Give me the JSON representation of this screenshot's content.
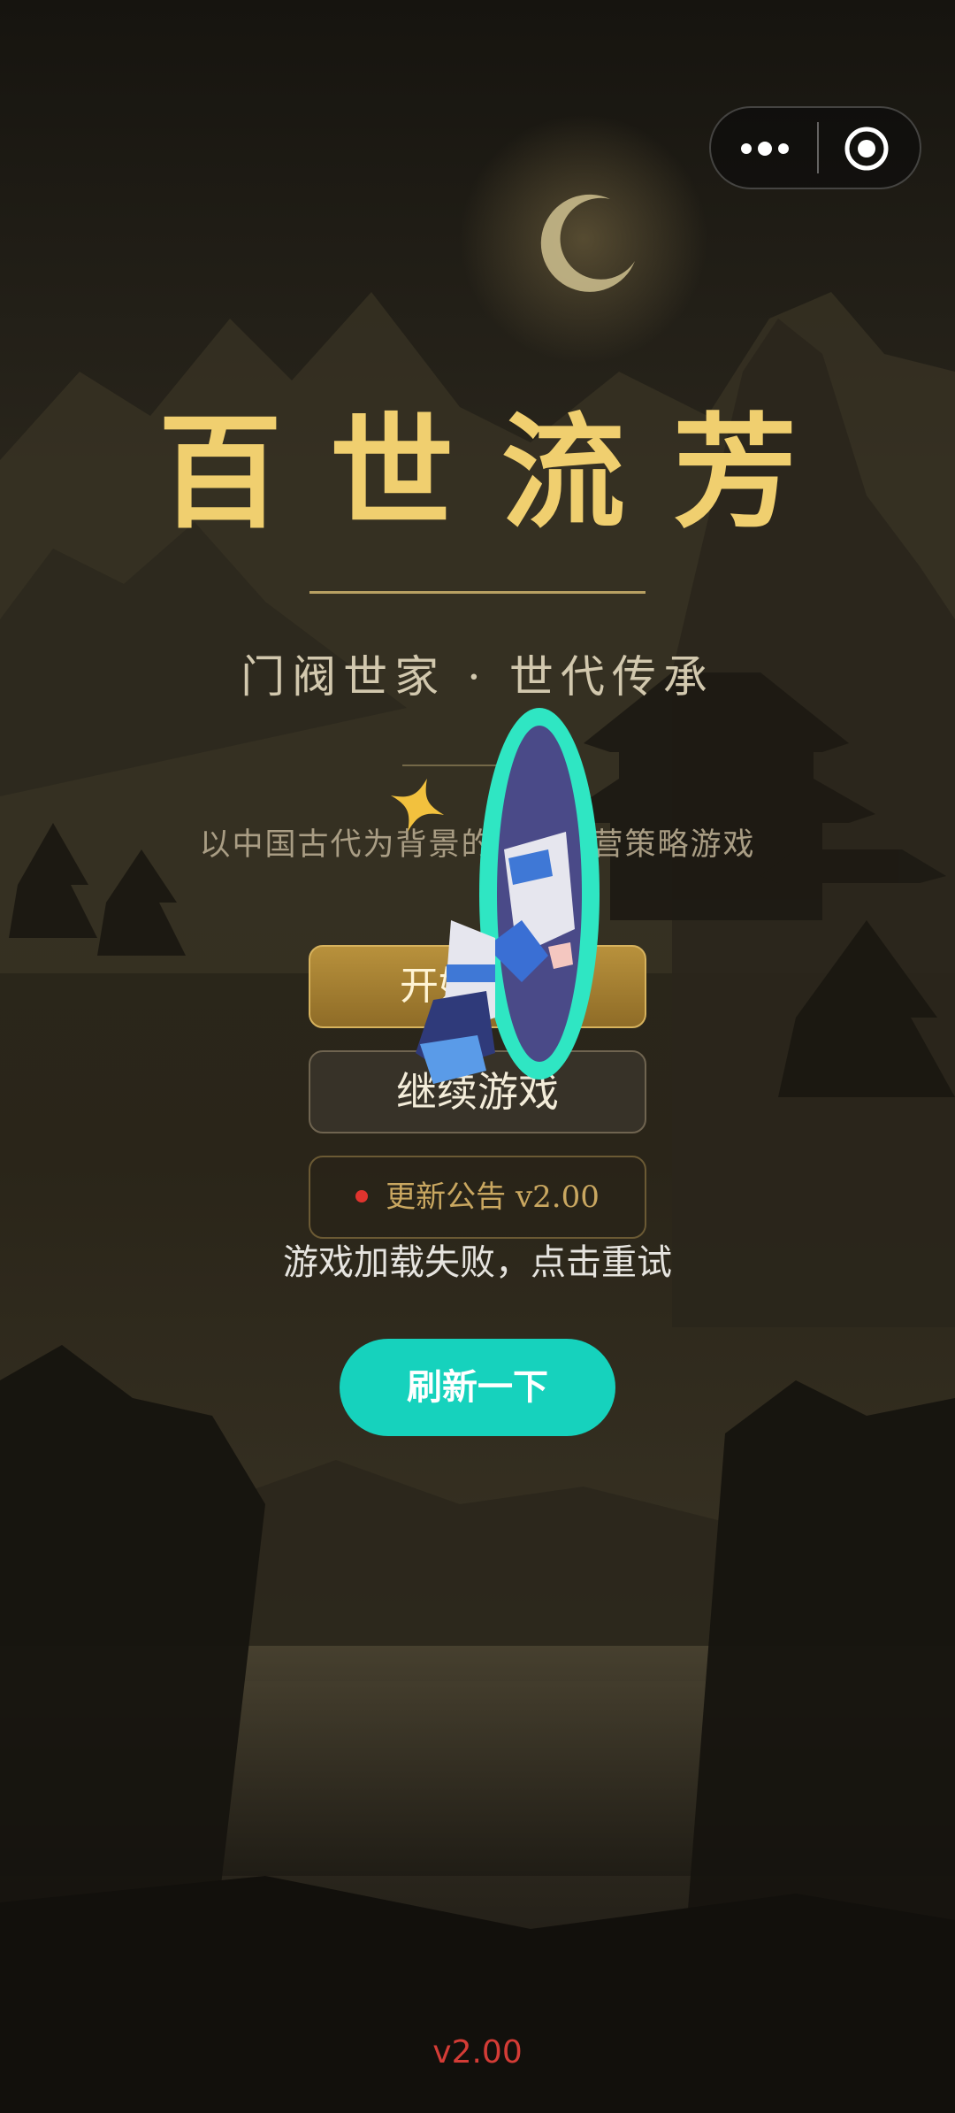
{
  "capsule": {
    "more_icon": "more-dots-icon",
    "close_icon": "target-circle-icon"
  },
  "game": {
    "title": "百世流芳",
    "subtitle": "门阀世家 · 世代传承",
    "description": "以中国古代为背景的家族经营策略游戏"
  },
  "buttons": {
    "start_label": "开始游戏",
    "continue_label": "继续游戏",
    "notice_label": "更新公告 v2.00"
  },
  "error": {
    "message": "游戏加载失败，点击重试",
    "refresh_label": "刷新一下"
  },
  "footer": {
    "version": "v2.00"
  },
  "colors": {
    "title_gold": "#f0cf6f",
    "refresh_teal": "#16d2bd",
    "version_red": "#d43c36",
    "notice_dot": "#e0342e"
  }
}
